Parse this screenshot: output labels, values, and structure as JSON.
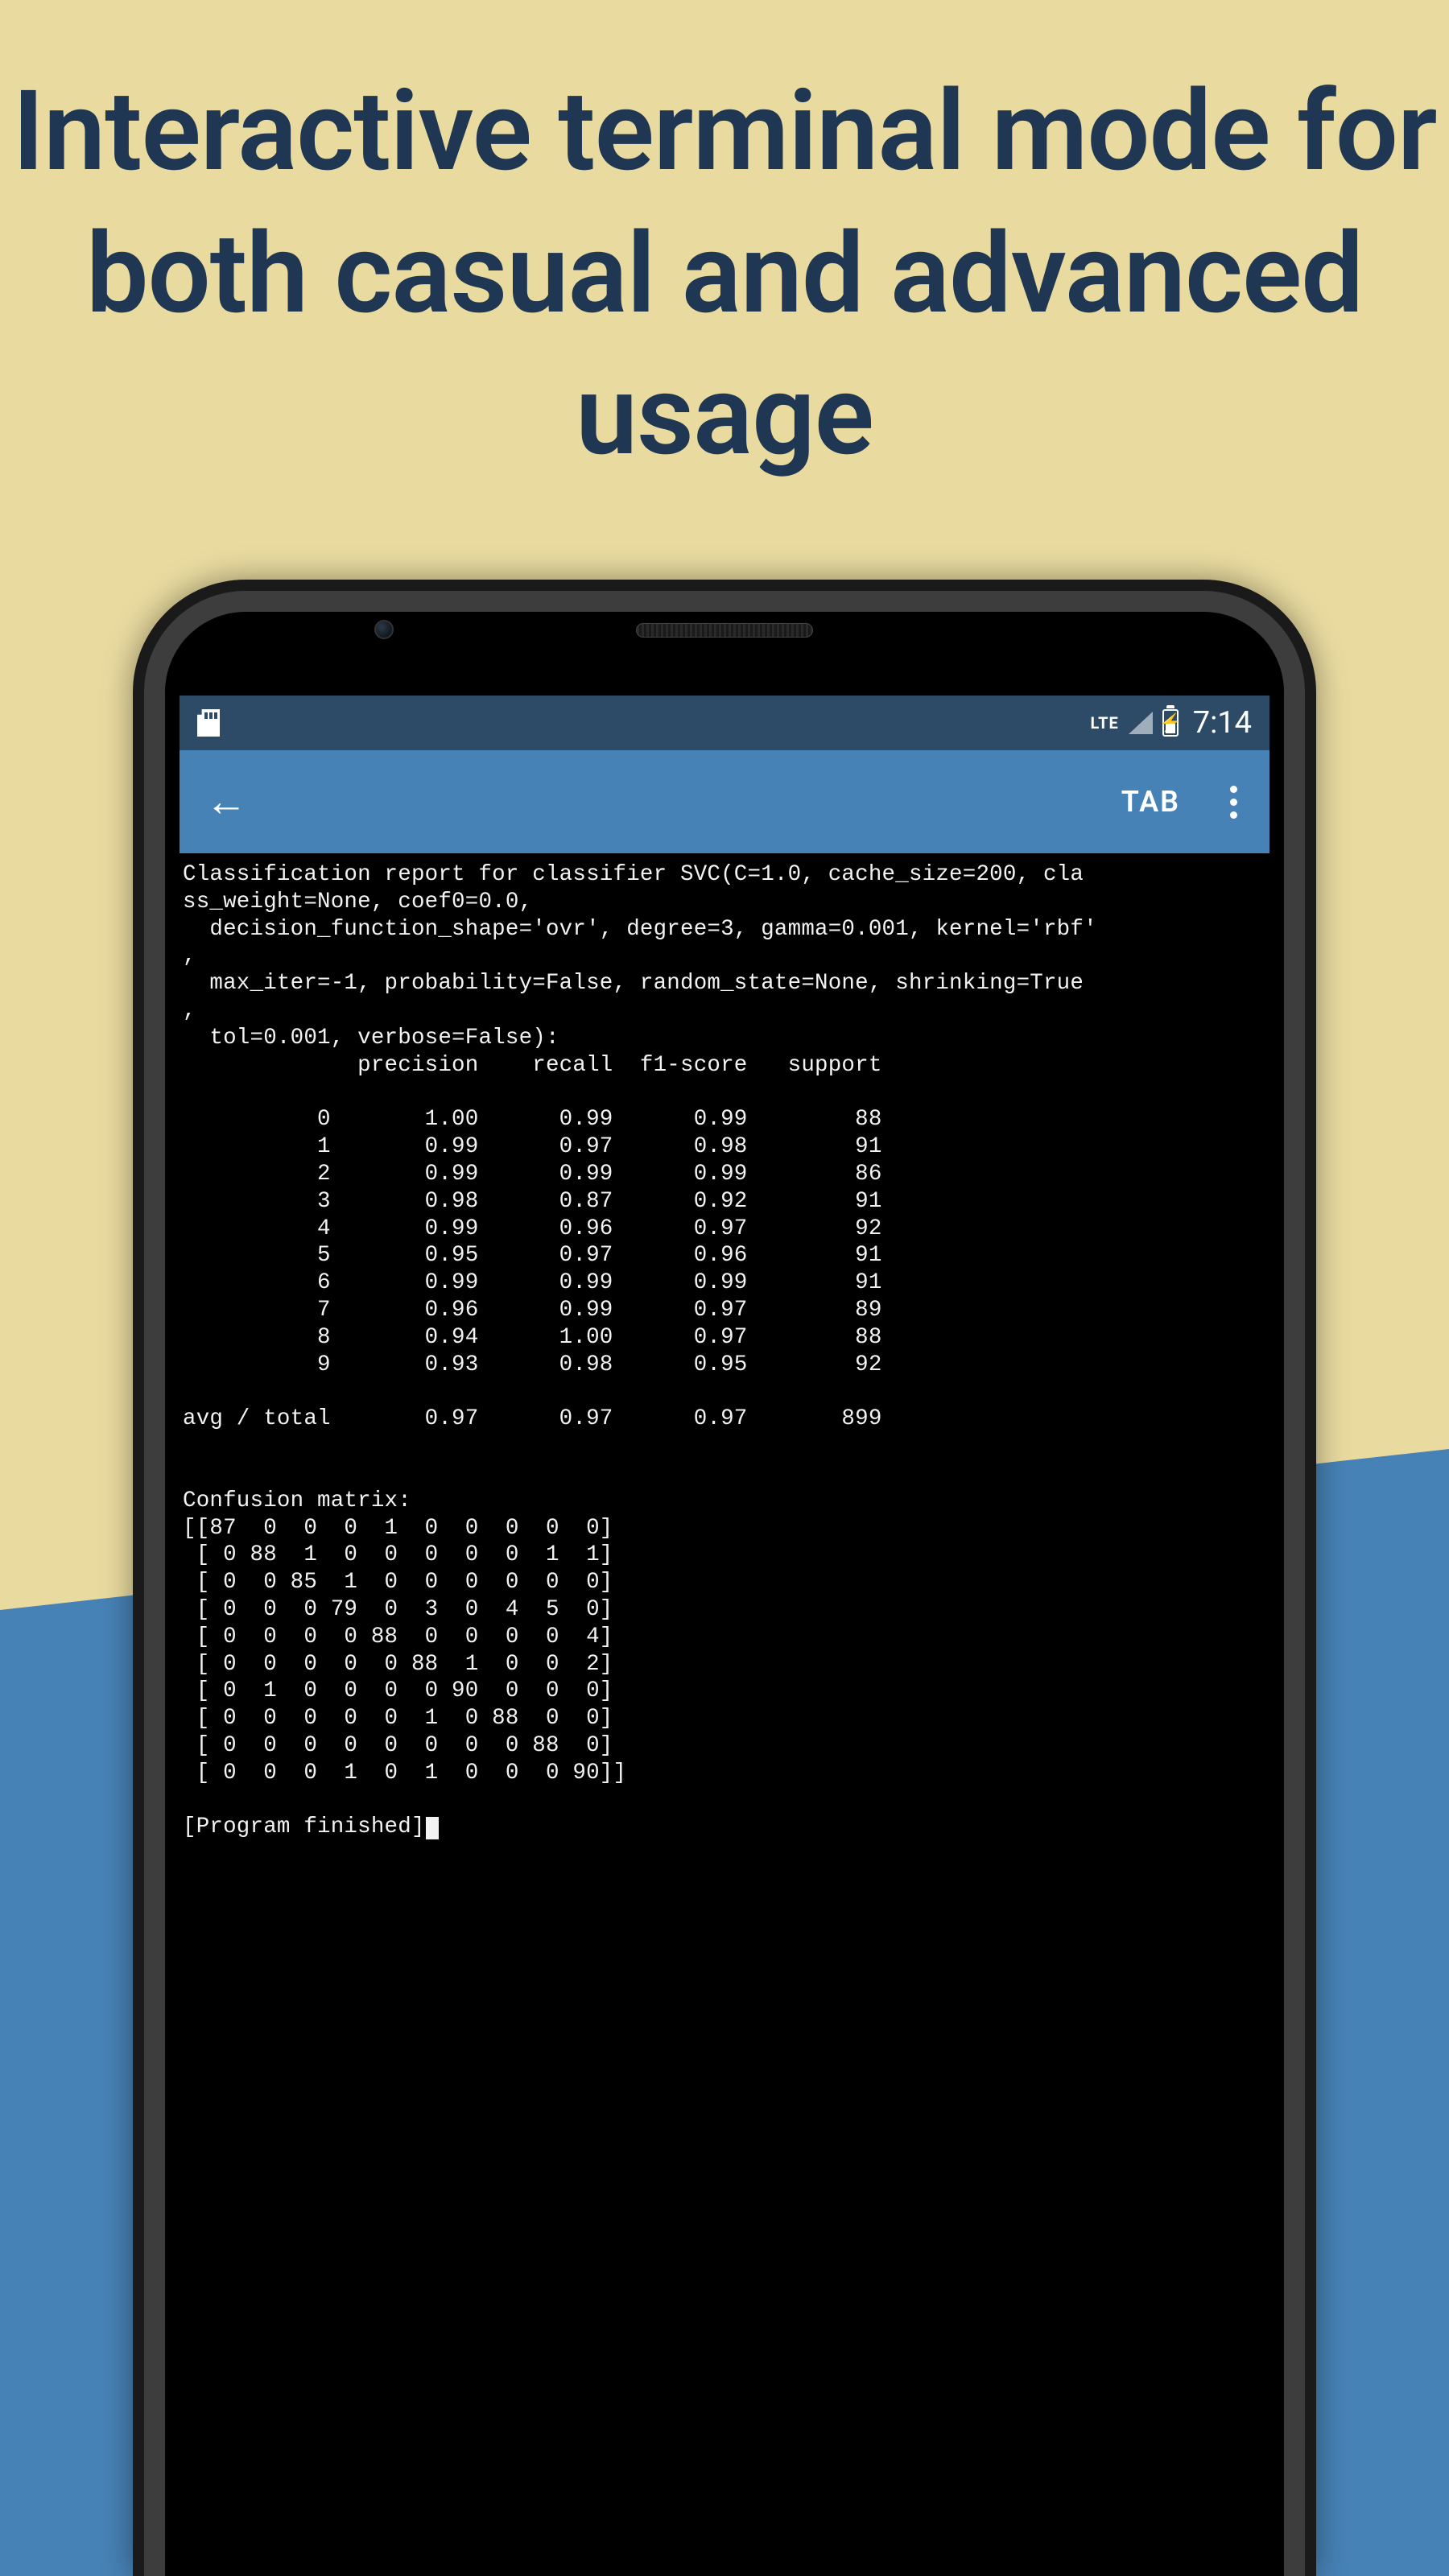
{
  "headline": "Interactive terminal mode for both casual and advanced usage",
  "status": {
    "network_label": "LTE",
    "time": "7:14"
  },
  "appbar": {
    "tab_label": "TAB"
  },
  "terminal": {
    "header": "Classification report for classifier SVC(C=1.0, cache_size=200, cla\nss_weight=None, coef0=0.0,\n  decision_function_shape='ovr', degree=3, gamma=0.001, kernel='rbf'\n,\n  max_iter=-1, probability=False, random_state=None, shrinking=True\n,\n  tol=0.001, verbose=False):",
    "col_header": "             precision    recall  f1-score   support",
    "rows": [
      {
        "label": "0",
        "precision": "1.00",
        "recall": "0.99",
        "f1": "0.99",
        "support": "88"
      },
      {
        "label": "1",
        "precision": "0.99",
        "recall": "0.97",
        "f1": "0.98",
        "support": "91"
      },
      {
        "label": "2",
        "precision": "0.99",
        "recall": "0.99",
        "f1": "0.99",
        "support": "86"
      },
      {
        "label": "3",
        "precision": "0.98",
        "recall": "0.87",
        "f1": "0.92",
        "support": "91"
      },
      {
        "label": "4",
        "precision": "0.99",
        "recall": "0.96",
        "f1": "0.97",
        "support": "92"
      },
      {
        "label": "5",
        "precision": "0.95",
        "recall": "0.97",
        "f1": "0.96",
        "support": "91"
      },
      {
        "label": "6",
        "precision": "0.99",
        "recall": "0.99",
        "f1": "0.99",
        "support": "91"
      },
      {
        "label": "7",
        "precision": "0.96",
        "recall": "0.99",
        "f1": "0.97",
        "support": "89"
      },
      {
        "label": "8",
        "precision": "0.94",
        "recall": "1.00",
        "f1": "0.97",
        "support": "88"
      },
      {
        "label": "9",
        "precision": "0.93",
        "recall": "0.98",
        "f1": "0.95",
        "support": "92"
      }
    ],
    "total": {
      "label": "avg / total",
      "precision": "0.97",
      "recall": "0.97",
      "f1": "0.97",
      "support": "899"
    },
    "confusion_label": "Confusion matrix:",
    "confusion_matrix": [
      [
        87,
        0,
        0,
        0,
        1,
        0,
        0,
        0,
        0,
        0
      ],
      [
        0,
        88,
        1,
        0,
        0,
        0,
        0,
        0,
        1,
        1
      ],
      [
        0,
        0,
        85,
        1,
        0,
        0,
        0,
        0,
        0,
        0
      ],
      [
        0,
        0,
        0,
        79,
        0,
        3,
        0,
        4,
        5,
        0
      ],
      [
        0,
        0,
        0,
        0,
        88,
        0,
        0,
        0,
        0,
        4
      ],
      [
        0,
        0,
        0,
        0,
        0,
        88,
        1,
        0,
        0,
        2
      ],
      [
        0,
        1,
        0,
        0,
        0,
        0,
        90,
        0,
        0,
        0
      ],
      [
        0,
        0,
        0,
        0,
        0,
        1,
        0,
        88,
        0,
        0
      ],
      [
        0,
        0,
        0,
        0,
        0,
        0,
        0,
        0,
        88,
        0
      ],
      [
        0,
        0,
        0,
        1,
        0,
        1,
        0,
        0,
        0,
        90
      ]
    ],
    "finished": "[Program finished]"
  }
}
